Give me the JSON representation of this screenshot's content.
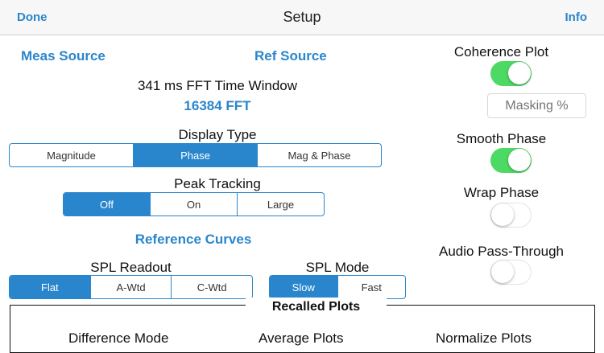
{
  "nav": {
    "left": "Done",
    "title": "Setup",
    "right": "Info"
  },
  "links": {
    "meas_source": "Meas Source",
    "ref_source": "Ref Source",
    "reference_curves": "Reference Curves"
  },
  "fft": {
    "window_label": "341 ms FFT Time Window",
    "size": "16384 FFT"
  },
  "display_type": {
    "label": "Display Type",
    "options": [
      "Magnitude",
      "Phase",
      "Mag & Phase"
    ],
    "selected": "Phase"
  },
  "peak_tracking": {
    "label": "Peak Tracking",
    "options": [
      "Off",
      "On",
      "Large"
    ],
    "selected": "Off"
  },
  "spl_readout": {
    "label": "SPL Readout",
    "options": [
      "Flat",
      "A-Wtd",
      "C-Wtd"
    ],
    "selected": "Flat"
  },
  "spl_mode": {
    "label": "SPL Mode",
    "options": [
      "Slow",
      "Fast"
    ],
    "selected": "Slow"
  },
  "toggles": {
    "coherence_plot": {
      "label": "Coherence Plot",
      "on": true
    },
    "smooth_phase": {
      "label": "Smooth Phase",
      "on": true
    },
    "wrap_phase": {
      "label": "Wrap Phase",
      "on": false
    },
    "audio_pass_through": {
      "label": "Audio Pass-Through",
      "on": false
    }
  },
  "masking": {
    "placeholder": "Masking %"
  },
  "recalled": {
    "title": "Recalled Plots",
    "difference_mode": "Difference Mode",
    "average_plots": "Average Plots",
    "normalize_plots": "Normalize Plots"
  },
  "colors": {
    "accent": "#2a86cc",
    "toggle_on": "#4cd964",
    "navbar": "#f7f7f7"
  }
}
